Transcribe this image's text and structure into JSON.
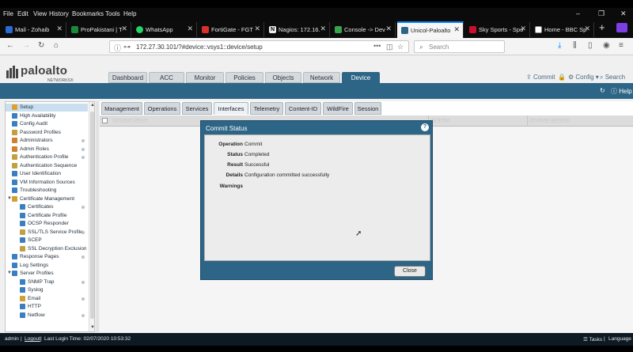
{
  "browser": {
    "menu": [
      "File",
      "Edit",
      "View",
      "History",
      "Bookmarks",
      "Tools",
      "Help"
    ],
    "window_controls": [
      "–",
      "❐",
      "✕"
    ],
    "tabs": [
      {
        "label": "Mail - Zohaib",
        "color": "#2a6bd6"
      },
      {
        "label": "ProPakistani | T",
        "color": "#1a8a3a"
      },
      {
        "label": "WhatsApp",
        "color": "#25d366"
      },
      {
        "label": "FortiGate - FGT",
        "color": "#d9302c"
      },
      {
        "label": "Nagios: 172.16.",
        "color": "#444444"
      },
      {
        "label": "Console -> Dev",
        "color": "#3aa34a"
      },
      {
        "label": "Unicol-Paloalto",
        "color": "#2d6586"
      },
      {
        "label": "Sky Sports - Spo",
        "color": "#c8102e"
      },
      {
        "label": "Home - BBC Sp",
        "color": "#222222"
      }
    ],
    "new_tab": "+",
    "url": "172.27.30.101/?#device::vsys1::device/setup",
    "url_dots": "•••",
    "search_placeholder": "Search"
  },
  "app": {
    "logo": {
      "name": "paloalto",
      "sub": "NETWORKS®"
    },
    "main_tabs": [
      "Dashboard",
      "ACC",
      "Monitor",
      "Policies",
      "Objects",
      "Network",
      "Device"
    ],
    "active_main_tab": "Device",
    "tools": {
      "commit": "Commit",
      "config": "Config ▾",
      "search": "Search"
    },
    "bluebar_help": "Help",
    "sub_tabs": [
      "Management",
      "Operations",
      "Services",
      "Interfaces",
      "Telemetry",
      "Content-ID",
      "WildFire",
      "Session"
    ],
    "active_sub_tab": "Interfaces",
    "table_headers": {
      "name": "Interface Name",
      "address": "Address",
      "services": "Services Enabled"
    },
    "sidebar": [
      {
        "label": "Setup",
        "indent": 0,
        "selected": true,
        "color": "#e0a030"
      },
      {
        "label": "High Availability",
        "indent": 0,
        "color": "#3a7fc0"
      },
      {
        "label": "Config Audit",
        "indent": 0,
        "color": "#3a7fc0"
      },
      {
        "label": "Password Profiles",
        "indent": 0,
        "color": "#c0a040"
      },
      {
        "label": "Administrators",
        "indent": 0,
        "color": "#d08030",
        "dot": true
      },
      {
        "label": "Admin Roles",
        "indent": 0,
        "color": "#d08030",
        "dot": true
      },
      {
        "label": "Authentication Profile",
        "indent": 0,
        "color": "#c0a040",
        "dot": true
      },
      {
        "label": "Authentication Sequence",
        "indent": 0,
        "color": "#c0a040"
      },
      {
        "label": "User Identification",
        "indent": 0,
        "color": "#3a7fc0"
      },
      {
        "label": "VM Information Sources",
        "indent": 0,
        "color": "#3a7fc0"
      },
      {
        "label": "Troubleshooting",
        "indent": 0,
        "color": "#3a7fc0"
      },
      {
        "label": "Certificate Management",
        "indent": 0,
        "color": "#d0a030",
        "caret": "▼"
      },
      {
        "label": "Certificates",
        "indent": 1,
        "color": "#3a7fc0",
        "dot": true
      },
      {
        "label": "Certificate Profile",
        "indent": 1,
        "color": "#3a7fc0"
      },
      {
        "label": "OCSP Responder",
        "indent": 1,
        "color": "#3a7fc0"
      },
      {
        "label": "SSL/TLS Service Profile",
        "indent": 1,
        "color": "#c0a040",
        "dot": true
      },
      {
        "label": "SCEP",
        "indent": 1,
        "color": "#3a7fc0"
      },
      {
        "label": "SSL Decryption Exclusion",
        "indent": 1,
        "color": "#c0a040"
      },
      {
        "label": "Response Pages",
        "indent": 0,
        "color": "#3a7fc0",
        "dot": true
      },
      {
        "label": "Log Settings",
        "indent": 0,
        "color": "#3a7fc0"
      },
      {
        "label": "Server Profiles",
        "indent": 0,
        "color": "#3a7fc0",
        "caret": "▼"
      },
      {
        "label": "SNMP Trap",
        "indent": 1,
        "color": "#3a7fc0",
        "dot": true
      },
      {
        "label": "Syslog",
        "indent": 1,
        "color": "#3a7fc0"
      },
      {
        "label": "Email",
        "indent": 1,
        "color": "#d0a030",
        "dot": true
      },
      {
        "label": "HTTP",
        "indent": 1,
        "color": "#3a7fc0"
      },
      {
        "label": "Netflow",
        "indent": 1,
        "color": "#3a7fc0",
        "dot": true
      }
    ],
    "modal": {
      "title": "Commit Status",
      "rows": [
        {
          "k": "Operation",
          "v": "Commit"
        },
        {
          "k": "Status",
          "v": "Completed"
        },
        {
          "k": "Result",
          "v": "Successful"
        },
        {
          "k": "Details",
          "v": "Configuration committed successfully"
        },
        {
          "k": "Warnings",
          "v": ""
        }
      ],
      "close": "Close"
    },
    "status_bar": {
      "user": "admin",
      "logout": "Logout",
      "last_login": "Last Login Time: 02/07/2020 10:53:32",
      "tasks": "Tasks",
      "language": "Language"
    }
  }
}
